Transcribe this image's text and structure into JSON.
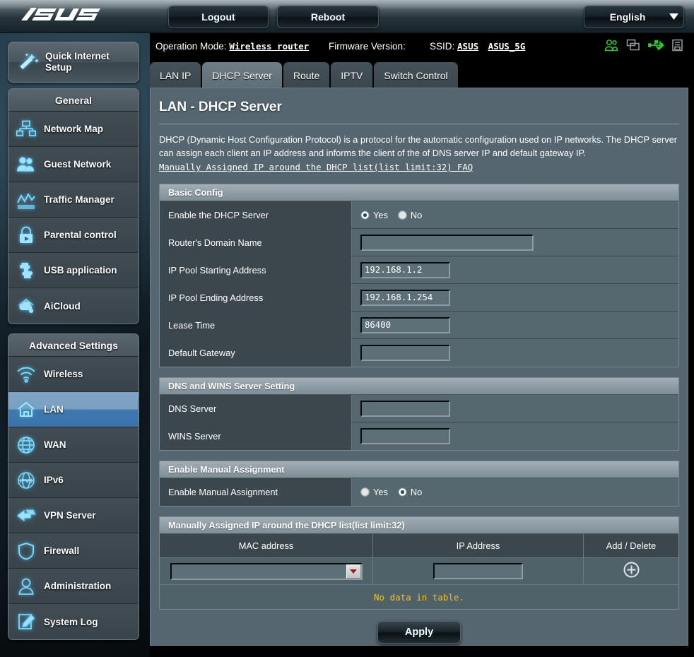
{
  "header": {
    "logo_text": "/ISUS",
    "logout_label": "Logout",
    "reboot_label": "Reboot",
    "language": "English",
    "language_arrow": "▼"
  },
  "status": {
    "operation_mode_label": "Operation Mode:",
    "operation_mode_value": "Wireless router",
    "firmware_label": "Firmware Version:",
    "firmware_value": "",
    "ssid_label": "SSID:",
    "ssid_value_1": "ASUS",
    "ssid_value_2": "ASUS_5G",
    "icons": [
      "clients-icon",
      "monitors-icon",
      "usb-icon",
      "printer-icon"
    ]
  },
  "sidebar": {
    "quick_setup_line1": "Quick Internet",
    "quick_setup_line2": "Setup",
    "groups": [
      {
        "title": "General",
        "items": [
          {
            "label": "Network Map",
            "icon": "network-map-icon",
            "active": false
          },
          {
            "label": "Guest Network",
            "icon": "guest-network-icon",
            "active": false
          },
          {
            "label": "Traffic Manager",
            "icon": "traffic-manager-icon",
            "active": false
          },
          {
            "label": "Parental control",
            "icon": "parental-control-icon",
            "active": false
          },
          {
            "label": "USB application",
            "icon": "usb-application-icon",
            "active": false
          },
          {
            "label": "AiCloud",
            "icon": "aicloud-icon",
            "active": false
          }
        ]
      },
      {
        "title": "Advanced Settings",
        "items": [
          {
            "label": "Wireless",
            "icon": "wireless-icon",
            "active": false
          },
          {
            "label": "LAN",
            "icon": "lan-icon",
            "active": true
          },
          {
            "label": "WAN",
            "icon": "wan-icon",
            "active": false
          },
          {
            "label": "IPv6",
            "icon": "ipv6-icon",
            "active": false
          },
          {
            "label": "VPN Server",
            "icon": "vpn-server-icon",
            "active": false
          },
          {
            "label": "Firewall",
            "icon": "firewall-icon",
            "active": false
          },
          {
            "label": "Administration",
            "icon": "administration-icon",
            "active": false
          },
          {
            "label": "System Log",
            "icon": "system-log-icon",
            "active": false
          }
        ]
      }
    ]
  },
  "tabs": [
    {
      "label": "LAN IP",
      "active": false
    },
    {
      "label": "DHCP Server",
      "active": true
    },
    {
      "label": "Route",
      "active": false
    },
    {
      "label": "IPTV",
      "active": false
    },
    {
      "label": "Switch Control",
      "active": false
    }
  ],
  "page": {
    "title": "LAN - DHCP Server",
    "description": "DHCP (Dynamic Host Configuration Protocol) is a protocol for the automatic configuration used on IP networks. The DHCP server can assign each client an IP address and informs the client of the of DNS server IP and default gateway IP.",
    "faq_link": "Manually Assigned IP around the DHCP list(list limit:32) FAQ"
  },
  "basic_config": {
    "section_title": "Basic Config",
    "enable_dhcp_label": "Enable the DHCP Server",
    "enable_dhcp_yes": "Yes",
    "enable_dhcp_no": "No",
    "enable_dhcp_value": "Yes",
    "domain_name_label": "Router's Domain Name",
    "domain_name_value": "",
    "pool_start_label": "IP Pool Starting Address",
    "pool_start_value": "192.168.1.2",
    "pool_end_label": "IP Pool Ending Address",
    "pool_end_value": "192.168.1.254",
    "lease_time_label": "Lease Time",
    "lease_time_value": "86400",
    "gateway_label": "Default Gateway",
    "gateway_value": ""
  },
  "dns_wins": {
    "section_title": "DNS and WINS Server Setting",
    "dns_label": "DNS Server",
    "dns_value": "",
    "wins_label": "WINS Server",
    "wins_value": ""
  },
  "manual_assignment": {
    "section_title": "Enable Manual Assignment",
    "enable_label": "Enable Manual Assignment",
    "yes_label": "Yes",
    "no_label": "No",
    "value": "No"
  },
  "assigned_table": {
    "section_title": "Manually Assigned IP around the DHCP list(list limit:32)",
    "columns": [
      "MAC address",
      "IP Address",
      "Add / Delete"
    ],
    "mac_value": "",
    "ip_value": "",
    "add_icon": "plus-circle-icon",
    "empty_text": "No data in table.",
    "rows": []
  },
  "footer": {
    "apply_label": "Apply"
  },
  "colors": {
    "accent_blue": "#49b9ec",
    "active_menu": "#3f78b0",
    "panel_bg": "#556670",
    "label_cell": "#3c474d",
    "value_cell": "#56686f",
    "warning_yellow": "#f3c11a",
    "dropdown_arrow_red": "#a21717",
    "status_green": "#2fc62f"
  }
}
